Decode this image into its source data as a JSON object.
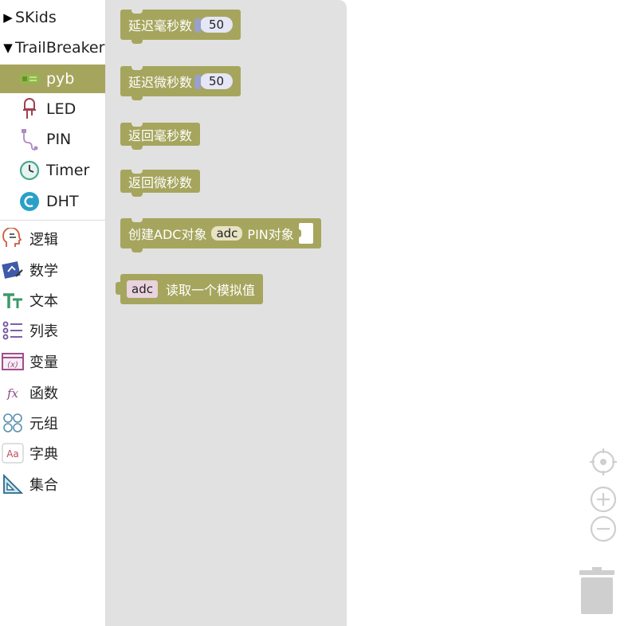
{
  "sidebar": {
    "tree": [
      {
        "arrow": "▶",
        "label": "SKids"
      },
      {
        "arrow": "▼",
        "label": "TrailBreaker"
      }
    ],
    "sub_items": [
      {
        "label": "pyb",
        "icon": "board-icon",
        "selected": true
      },
      {
        "label": "LED",
        "icon": "led-icon"
      },
      {
        "label": "PIN",
        "icon": "pin-icon"
      },
      {
        "label": "Timer",
        "icon": "timer-icon"
      },
      {
        "label": "DHT",
        "icon": "dht-icon"
      }
    ],
    "categories": [
      {
        "label": "逻辑",
        "icon": "logic-icon"
      },
      {
        "label": "数学",
        "icon": "math-icon"
      },
      {
        "label": "文本",
        "icon": "text-icon"
      },
      {
        "label": "列表",
        "icon": "list-icon"
      },
      {
        "label": "变量",
        "icon": "variable-icon"
      },
      {
        "label": "函数",
        "icon": "function-icon"
      },
      {
        "label": "元组",
        "icon": "tuple-icon"
      },
      {
        "label": "字典",
        "icon": "dict-icon"
      },
      {
        "label": "集合",
        "icon": "set-icon"
      }
    ]
  },
  "flyout": {
    "block1": {
      "label": "延迟毫秒数",
      "value": "50"
    },
    "block2": {
      "label": "延迟微秒数",
      "value": "50"
    },
    "block3": {
      "label": "返回毫秒数"
    },
    "block4": {
      "label": "返回微秒数"
    },
    "block5": {
      "prefix": "创建ADC对象",
      "var": "adc",
      "suffix": "PIN对象"
    },
    "block6": {
      "var": "adc",
      "label": "读取一个模拟值"
    }
  },
  "colors": {
    "block": "#a6a55d",
    "flyout_bg": "#e1e1e1",
    "selected_bg": "#a6a55d"
  }
}
